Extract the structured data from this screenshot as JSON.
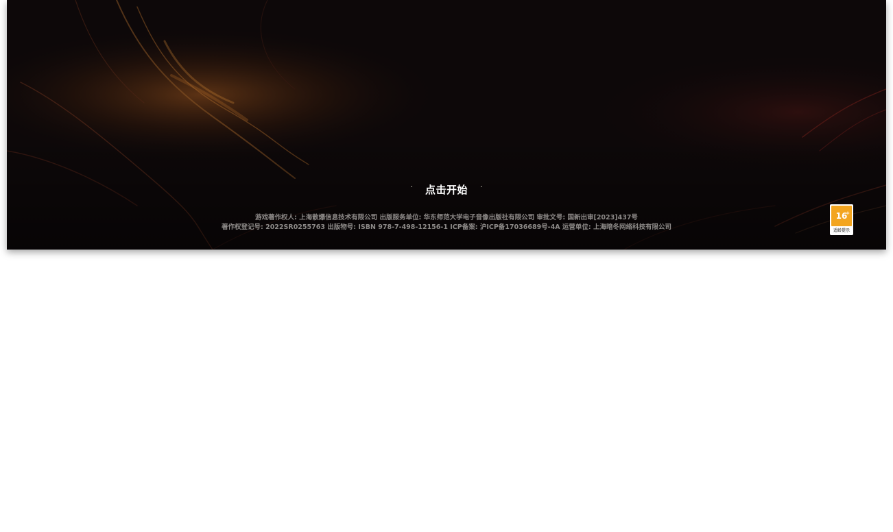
{
  "start": {
    "label": "点击开始",
    "deco_left": "·",
    "deco_right": "·"
  },
  "credits": {
    "line1": "游戏著作权人: 上海散爆信息技术有限公司  出版服务单位: 华东师范大学电子音像出版社有限公司  审批文号: 国新出审[2023]437号",
    "line2": "著作权登记号: 2022SR0255763 出版物号: ISBN 978-7-498-12156-1 ICP备案: 沪ICP备17036689号-4A 运营单位: 上海暗冬网络科技有限公司"
  },
  "age_rating": {
    "age": "16",
    "plus": "+",
    "caption": "适龄提示",
    "color": "#f3a51f"
  },
  "colors": {
    "background": "#0b0708",
    "page": "#ffffff",
    "accent_glow": "#b86b22"
  }
}
